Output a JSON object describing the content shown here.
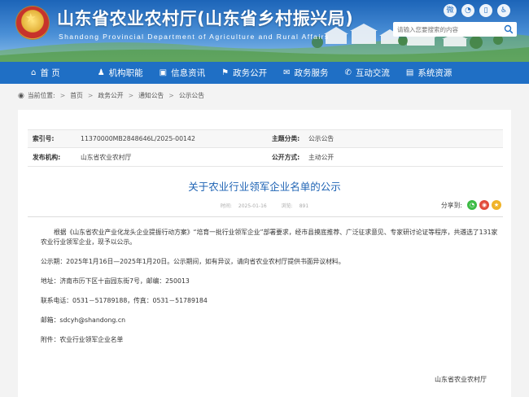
{
  "header": {
    "title": "山东省农业农村厅(山东省乡村振兴局)",
    "subtitle": "Shandong Provincial Department of Agriculture and Rural Affairs",
    "search_placeholder": "请输入您要搜索的内容",
    "social_icons": [
      "weibo-icon",
      "wechat-icon",
      "mobile-icon",
      "accessibility-icon"
    ]
  },
  "nav": {
    "items": [
      {
        "label": "首 页",
        "icon": "home-icon"
      },
      {
        "label": "机构职能",
        "icon": "org-icon"
      },
      {
        "label": "信息资讯",
        "icon": "info-icon"
      },
      {
        "label": "政务公开",
        "icon": "gov-icon"
      },
      {
        "label": "政务服务",
        "icon": "service-icon"
      },
      {
        "label": "互动交流",
        "icon": "chat-icon"
      },
      {
        "label": "系统资源",
        "icon": "system-icon"
      }
    ]
  },
  "breadcrumb": {
    "prefix": "当前位置:",
    "items": [
      "首页",
      "政务公开",
      "通知公告",
      "公示公告"
    ]
  },
  "meta": {
    "index_label": "索引号:",
    "index_value": "11370000MB2848646L/2025-00142",
    "topic_label": "主题分类:",
    "topic_value": "公示公告",
    "publisher_label": "发布机构:",
    "publisher_value": "山东省农业农村厅",
    "open_label": "公开方式:",
    "open_value": "主动公开"
  },
  "document": {
    "title": "关于农业行业领军企业名单的公示",
    "time_label": "时间:",
    "time_value": "2025-01-16",
    "views_label": "浏览:",
    "views_value": "891",
    "share_label": "分享到:",
    "paragraphs": [
      "根据《山东省农业产业化龙头企业提振行动方案》“培育一批行业领军企业”部署要求，经市县摸底推荐、广泛征求意见、专家研讨论证等程序，共遴选了131家农业行业领军企业，现予以公示。",
      "公示期：2025年1月16日—2025年1月20日。公示期间，如有异议，请向省农业农村厅提供书面异议材料。",
      "地址：济南市历下区十亩园东街7号，邮编：250013",
      "联系电话：0531－51789188，传真：0531－51789184",
      "邮箱：sdcyh@shandong.cn",
      "附件：农业行业领军企业名单"
    ],
    "signature": "山东省农业农村厅"
  },
  "colors": {
    "brand_blue": "#1f6fc5",
    "title_blue": "#1e63b4"
  }
}
